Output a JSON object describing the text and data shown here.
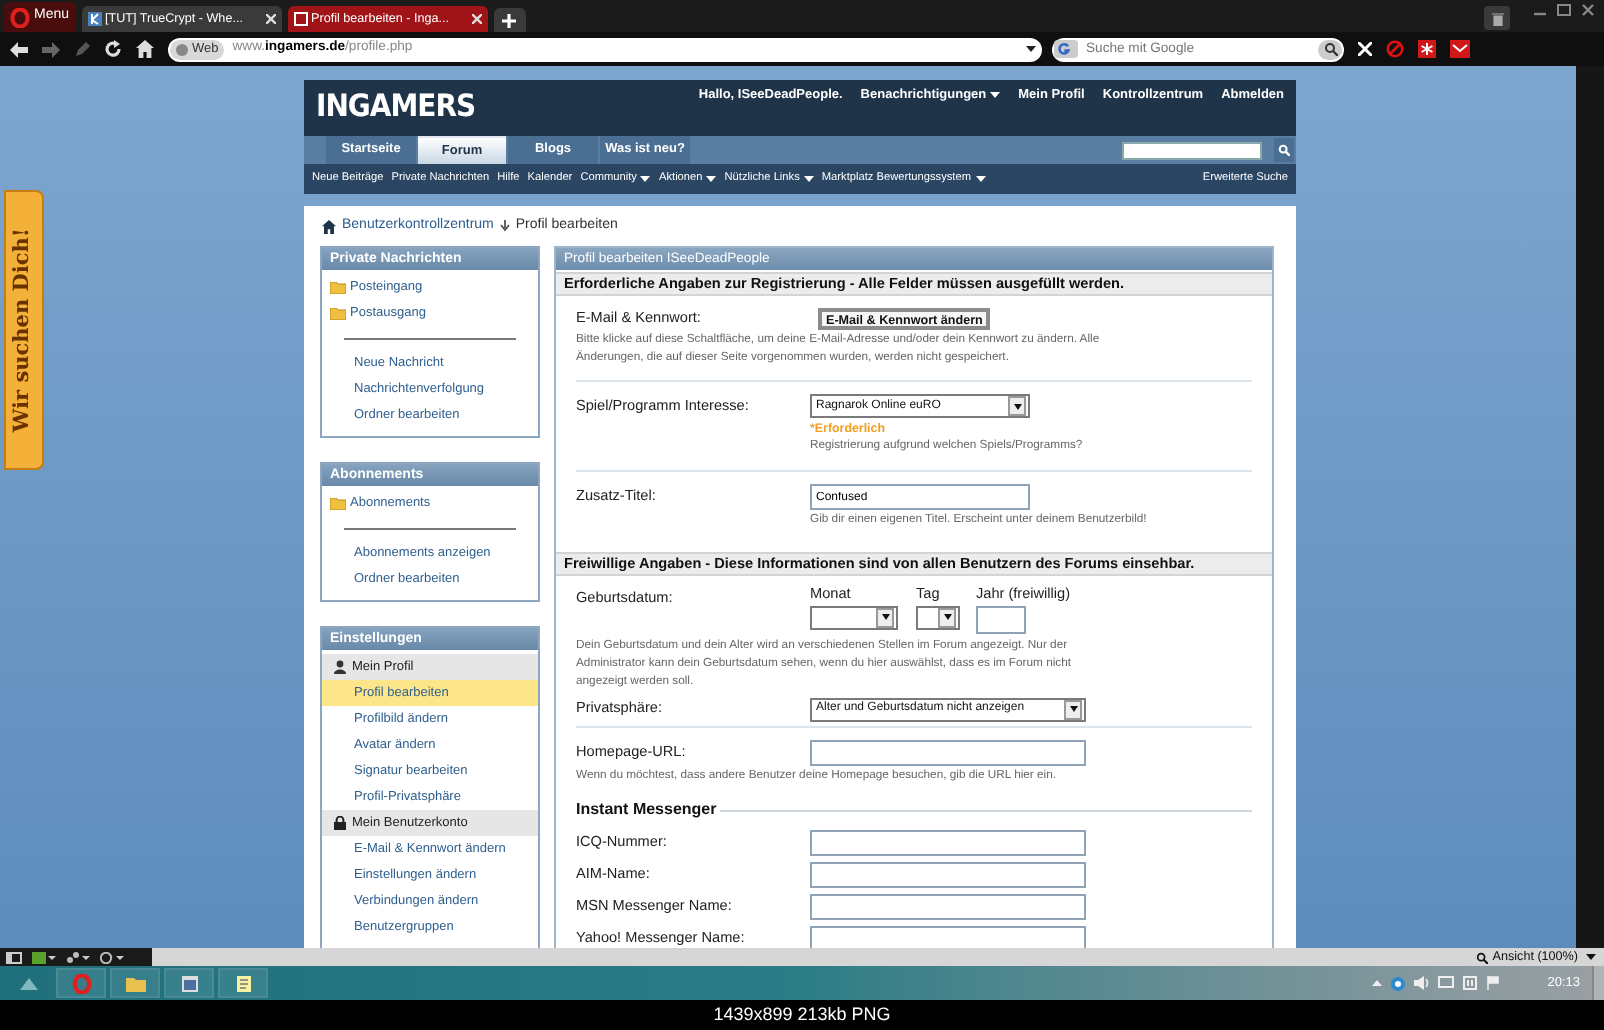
{
  "browser": {
    "menu_label": "Menu",
    "tabs": [
      {
        "label": "[TUT] TrueCrypt - Whe...",
        "selected": false
      },
      {
        "label": "Profil bearbeiten - Inga...",
        "selected": true
      }
    ],
    "address": {
      "badge": "Web",
      "url": "www.**ingamers.de**/profile.php"
    },
    "search": {
      "placeholder": "Suche mit Google"
    }
  },
  "side_banner": {
    "label": "Wir suchen Dich!"
  },
  "site": {
    "logo": "INGAMERS",
    "user_links": [
      {
        "label": "Hallo, ISeeDeadPeople.",
        "dropdown": false
      },
      {
        "label": "Benachrichtigungen",
        "dropdown": true
      },
      {
        "label": "Mein Profil",
        "dropdown": false
      },
      {
        "label": "Kontrollzentrum",
        "dropdown": false
      },
      {
        "label": "Abmelden",
        "dropdown": false
      }
    ],
    "tabs": [
      {
        "label": "Startseite",
        "selected": false
      },
      {
        "label": "Forum",
        "selected": true
      },
      {
        "label": "Blogs",
        "selected": false
      },
      {
        "label": "Was ist neu?",
        "selected": false
      }
    ],
    "subnav": [
      {
        "label": "Neue Beiträge",
        "dropdown": false
      },
      {
        "label": "Private Nachrichten",
        "dropdown": false
      },
      {
        "label": "Hilfe",
        "dropdown": false
      },
      {
        "label": "Kalender",
        "dropdown": false
      },
      {
        "label": "Community",
        "dropdown": true
      },
      {
        "label": "Aktionen",
        "dropdown": true
      },
      {
        "label": "Nützliche Links",
        "dropdown": true
      },
      {
        "label": "Marktplatz Bewertungssystem",
        "dropdown": true
      }
    ],
    "advanced_search": "Erweiterte Suche"
  },
  "breadcrumb": [
    "Benutzerkontrollzentrum",
    "Profil bearbeiten"
  ],
  "sidebar": [
    {
      "title": "Private Nachrichten",
      "items": [
        {
          "kind": "folder",
          "label": "Posteingang",
          "selected": false
        },
        {
          "kind": "folder",
          "label": "Postausgang",
          "selected": false
        },
        {
          "kind": "link",
          "label": "Neue Nachricht",
          "selected": false
        },
        {
          "kind": "link",
          "label": "Nachrichtenverfolgung",
          "selected": false
        },
        {
          "kind": "link",
          "label": "Ordner bearbeiten",
          "selected": false
        }
      ]
    },
    {
      "title": "Abonnements",
      "items": [
        {
          "kind": "folder",
          "label": "Abonnements",
          "selected": false
        },
        {
          "kind": "link",
          "label": "Abonnements anzeigen",
          "selected": false
        },
        {
          "kind": "link",
          "label": "Ordner bearbeiten",
          "selected": false
        }
      ]
    },
    {
      "title": "Einstellungen",
      "items": [
        {
          "kind": "profileheading",
          "label": "Mein Profil"
        },
        {
          "kind": "link",
          "label": "Profil bearbeiten",
          "selected": true
        },
        {
          "kind": "link",
          "label": "Profilbild ändern",
          "selected": false
        },
        {
          "kind": "link",
          "label": "Avatar ändern",
          "selected": false
        },
        {
          "kind": "link",
          "label": "Signatur bearbeiten",
          "selected": false
        },
        {
          "kind": "link",
          "label": "Profil-Privatsphäre",
          "selected": false
        },
        {
          "kind": "accountheading",
          "label": "Mein Benutzerkonto"
        },
        {
          "kind": "link",
          "label": "E-Mail & Kennwort ändern",
          "selected": false
        },
        {
          "kind": "link",
          "label": "Einstellungen ändern",
          "selected": false
        },
        {
          "kind": "link",
          "label": "Verbindungen ändern",
          "selected": false
        },
        {
          "kind": "link",
          "label": "Benutzergruppen",
          "selected": false
        }
      ]
    }
  ],
  "main": {
    "title": "Profil bearbeiten ISeeDeadPeople",
    "sections": [
      {
        "heading": "Erforderliche Angaben zur Registrierung - Alle Felder müssen ausgefüllt werden.",
        "fields": [
          {
            "kind": "button",
            "label": "E-Mail & Kennwort:",
            "button": "E-Mail & Kennwort ändern",
            "help": "Bitte klicke auf diese Schaltfläche, um deine E-Mail-Adresse und/oder dein Kennwort zu ändern. Alle Änderungen, die auf dieser Seite vorgenommen wurden, werden nicht gespeichert."
          },
          {
            "kind": "select",
            "label": "Spiel/Programm Interesse:",
            "value": "Ragnarok Online euRO",
            "required": "*Erforderlich",
            "help": "Registrierung aufgrund welchen Spiels/Programms?"
          },
          {
            "kind": "text",
            "label": "Zusatz-Titel:",
            "value": "Confused",
            "help": "Gib dir einen eigenen Titel. Erscheint unter deinem Benutzerbild!"
          }
        ]
      },
      {
        "heading": "Freiwillige Angaben - Diese Informationen sind von allen Benutzern des Forums einsehbar.",
        "fields": [
          {
            "kind": "date",
            "label": "Geburtsdatum:",
            "month_label": "Monat",
            "day_label": "Tag",
            "year_label": "Jahr (freiwillig)",
            "help": "Dein Geburtsdatum und dein Alter wird an verschiedenen Stellen im Forum angezeigt. Nur der Administrator kann dein Geburtsdatum sehen, wenn du hier auswählst, dass es im Forum nicht angezeigt werden soll.",
            "privacy_label": "Privatsphäre:",
            "privacy_value": "Alter und Geburtsdatum nicht anzeigen"
          },
          {
            "kind": "url",
            "label": "Homepage-URL:",
            "help": "Wenn du möchtest, dass andere Benutzer deine Homepage besuchen, gib die URL hier ein."
          },
          {
            "kind": "subheading",
            "label": "Instant Messenger"
          },
          {
            "kind": "im",
            "label": "ICQ-Nummer:"
          },
          {
            "kind": "im",
            "label": "AIM-Name:"
          },
          {
            "kind": "im",
            "label": "MSN Messenger Name:"
          },
          {
            "kind": "im",
            "label": "Yahoo! Messenger Name:"
          }
        ]
      }
    ]
  },
  "status_bar": {
    "zoom": "Ansicht (100%)"
  },
  "taskbar": {
    "clock": "20:13"
  },
  "caption": "1439x899 213kb PNG"
}
